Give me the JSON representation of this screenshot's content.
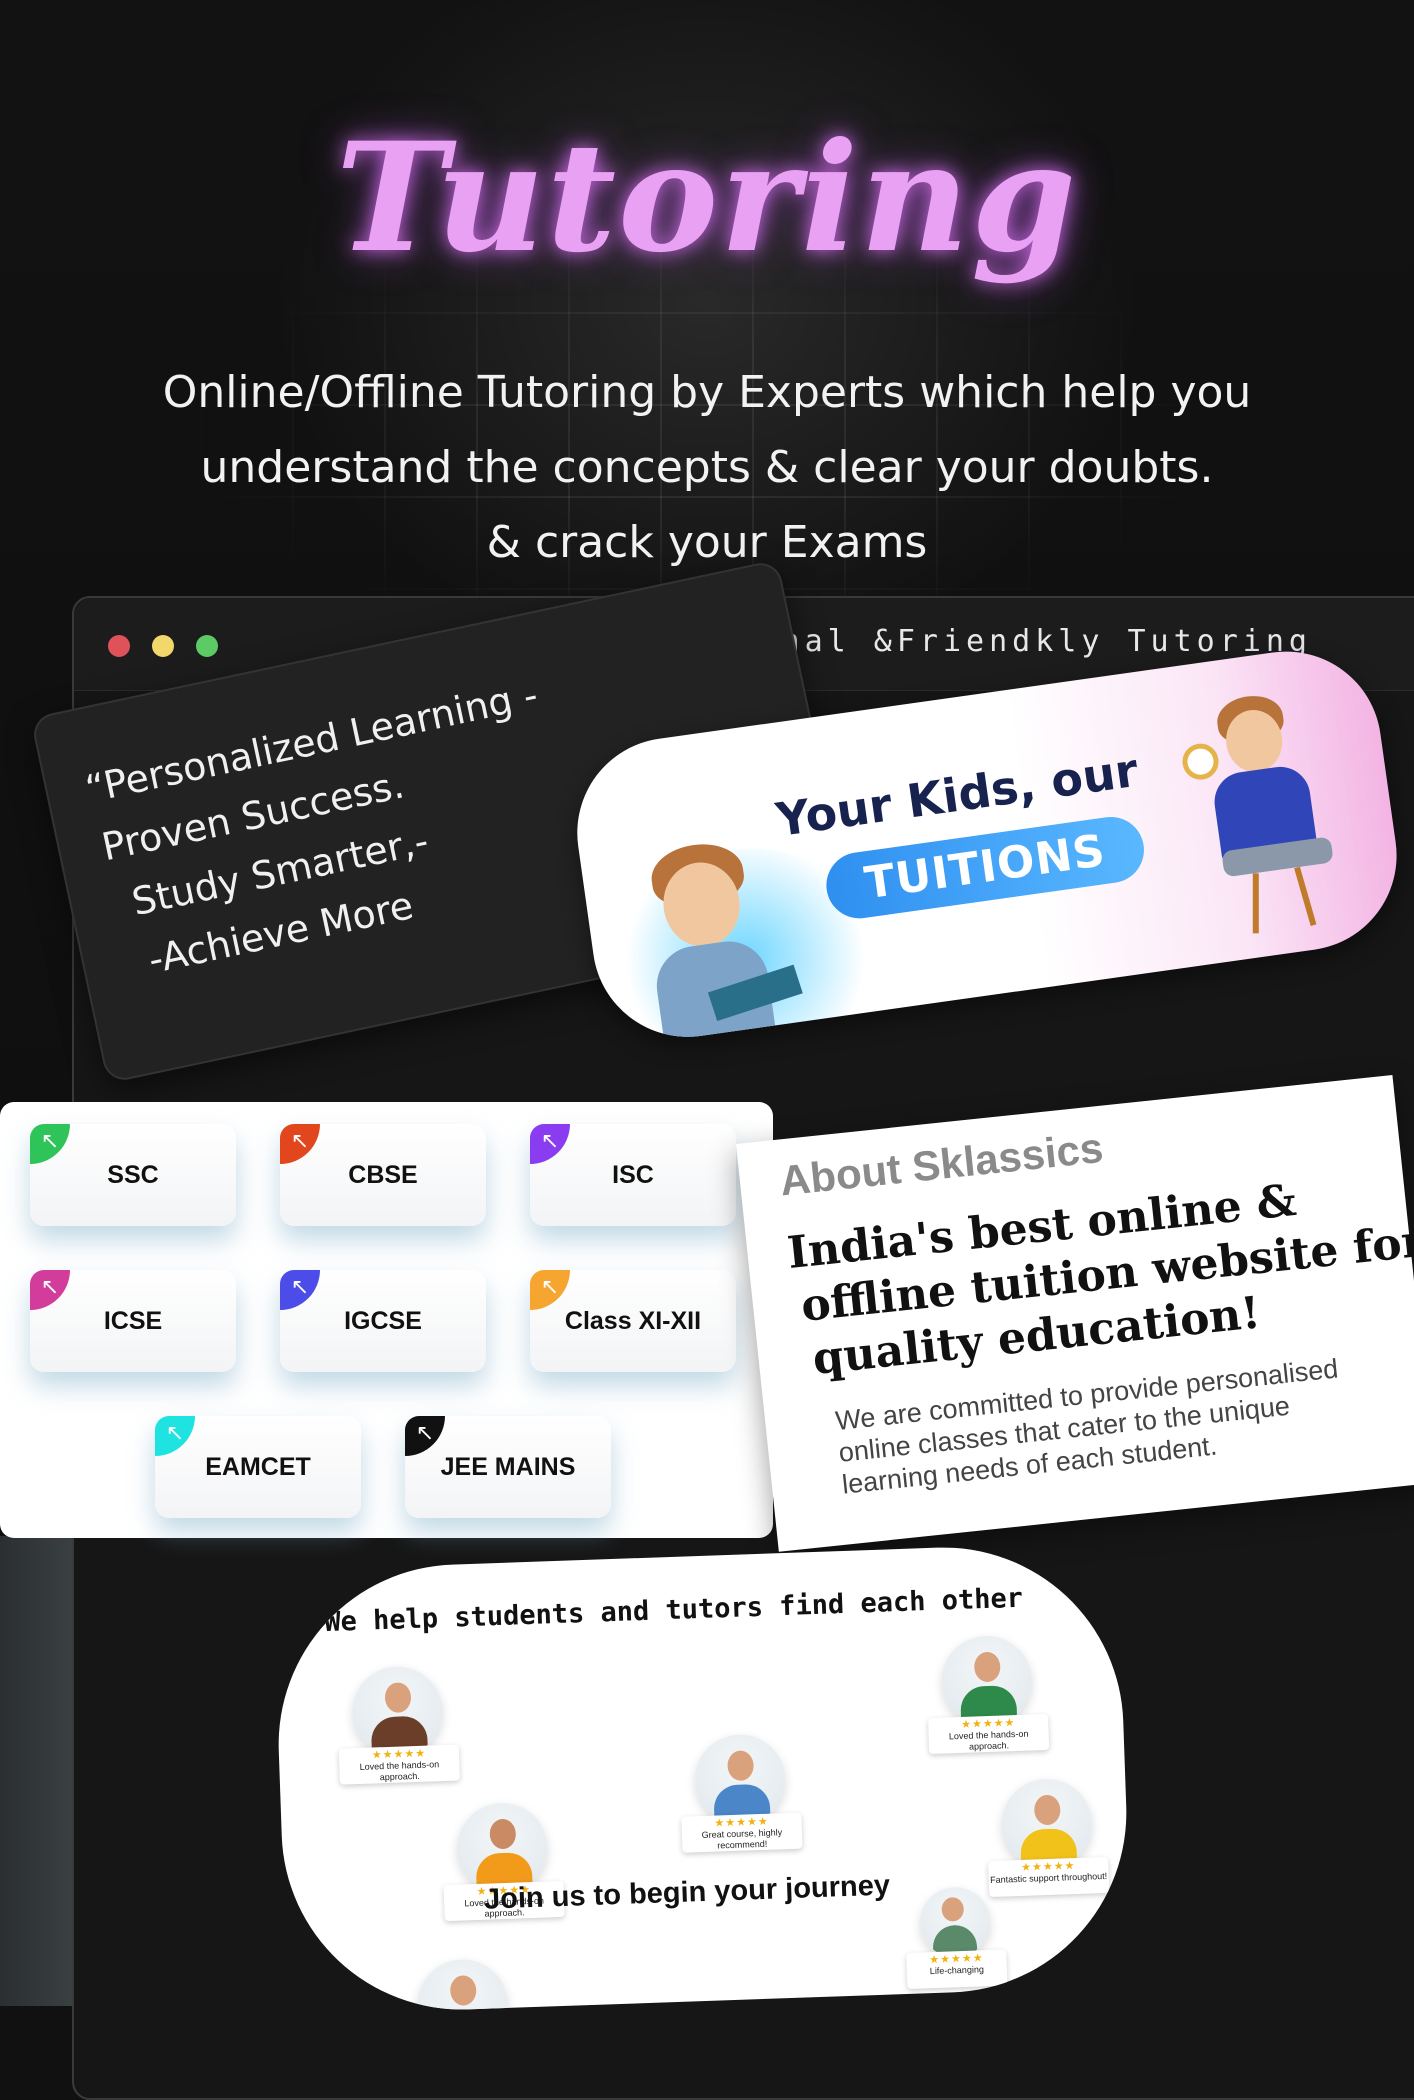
{
  "page": {
    "title": "Tutoring",
    "subtitle_lines": [
      "Online/Offline Tutoring by Experts which help you",
      "understand the concepts & clear your doubts.",
      "& crack your Exams"
    ]
  },
  "window": {
    "title": "Professional &Friendkly Tutoring"
  },
  "quote": {
    "lines": [
      "“Personalized Learning -",
      "Proven Success.",
      "Study Smarter,-",
      "-Achieve More"
    ]
  },
  "banner": {
    "heading": "Your Kids, our",
    "pill": "TUITIONS"
  },
  "boards": {
    "items": [
      {
        "label": "SSC",
        "color": "#2fc45a"
      },
      {
        "label": "CBSE",
        "color": "#e2461c"
      },
      {
        "label": "ISC",
        "color": "#8a3cf0"
      },
      {
        "label": "ICSE",
        "color": "#d23c9a"
      },
      {
        "label": "IGCSE",
        "color": "#4c4ce8"
      },
      {
        "label": "Class XI-XII",
        "color": "#f7a531"
      },
      {
        "label": "EAMCET",
        "color": "#1fe3e0"
      },
      {
        "label": "JEE MAINS",
        "color": "#111111"
      }
    ],
    "corner_icon": "arrow-up-left-icon"
  },
  "about": {
    "kicker": "About Sklassics",
    "heading_lines": [
      "India's best online &",
      "offline tuition website for",
      "quality education!"
    ],
    "body_lines": [
      "We are committed to provide personalised",
      "online classes that cater to the unique",
      "learning needs of each student."
    ]
  },
  "testimonials": {
    "heading": "We help students and tutors find each other",
    "cta": "Join us to begin your journey",
    "stars": "★★★★★",
    "reviews": [
      {
        "text": "Loved the hands-on approach."
      },
      {
        "text": "Loved the hands-on approach."
      },
      {
        "text": "Great course, highly recommend!"
      },
      {
        "text": "Loved the hands-on approach."
      },
      {
        "text": "Fantastic support throughout!"
      },
      {
        "text": "Life-changing"
      }
    ]
  }
}
